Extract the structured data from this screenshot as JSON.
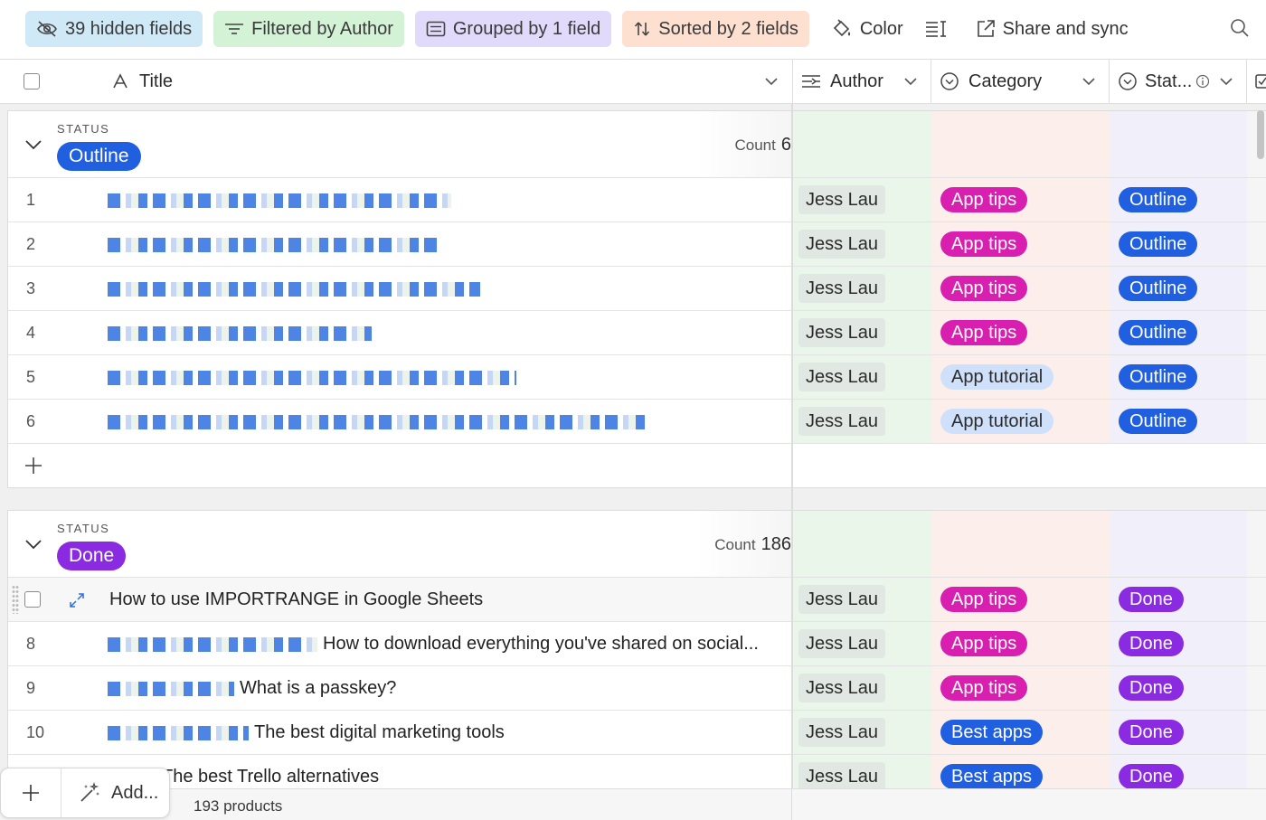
{
  "toolbar": {
    "hidden_fields": "39 hidden fields",
    "filter": "Filtered by Author",
    "group": "Grouped by 1 field",
    "sort": "Sorted by 2 fields",
    "color": "Color",
    "share": "Share and sync"
  },
  "columns": {
    "title": "Title",
    "author": "Author",
    "category": "Category",
    "status": "Stat..."
  },
  "groups": [
    {
      "label": "STATUS",
      "value": "Outline",
      "count_label": "Count",
      "count": "6",
      "rows": [
        {
          "num": "1",
          "title": "",
          "author": "Jess Lau",
          "category": "App tips",
          "status": "Outline"
        },
        {
          "num": "2",
          "title": "",
          "author": "Jess Lau",
          "category": "App tips",
          "status": "Outline"
        },
        {
          "num": "3",
          "title": "",
          "author": "Jess Lau",
          "category": "App tips",
          "status": "Outline"
        },
        {
          "num": "4",
          "title": "",
          "author": "Jess Lau",
          "category": "App tips",
          "status": "Outline"
        },
        {
          "num": "5",
          "title": "",
          "author": "Jess Lau",
          "category": "App tutorial",
          "status": "Outline"
        },
        {
          "num": "6",
          "title": "",
          "author": "Jess Lau",
          "category": "App tutorial",
          "status": "Outline"
        }
      ]
    },
    {
      "label": "STATUS",
      "value": "Done",
      "count_label": "Count",
      "count": "186",
      "rows": [
        {
          "num": "",
          "title": "How to use IMPORTRANGE in Google Sheets",
          "author": "Jess Lau",
          "category": "App tips",
          "status": "Done"
        },
        {
          "num": "8",
          "title": "How to download everything you've shared on social...",
          "author": "Jess Lau",
          "category": "App tips",
          "status": "Done"
        },
        {
          "num": "9",
          "title": "What is a passkey?",
          "author": "Jess Lau",
          "category": "App tips",
          "status": "Done"
        },
        {
          "num": "10",
          "title": "The best digital marketing tools",
          "author": "Jess Lau",
          "category": "Best apps",
          "status": "Done"
        },
        {
          "num": "",
          "title": "The best Trello alternatives",
          "author": "Jess Lau",
          "category": "Best apps",
          "status": "Done"
        }
      ]
    }
  ],
  "footer": {
    "add_label": "Add...",
    "record_count": "193 products"
  },
  "colors": {
    "outline": "#1f5fe0",
    "done": "#8a2be2",
    "app_tips": "#d81fb0",
    "app_tutorial": "#cfe0fb",
    "best_apps": "#1f5fe0"
  },
  "icons": [
    "eye-slash-icon",
    "filter-icon",
    "group-icon",
    "sort-icon",
    "color-icon",
    "row-height-icon",
    "share-icon",
    "search-icon",
    "chevron-down-icon",
    "text-field-icon",
    "linked-field-icon",
    "single-select-icon",
    "info-icon",
    "plus-icon",
    "expand-icon",
    "magic-wand-icon"
  ]
}
